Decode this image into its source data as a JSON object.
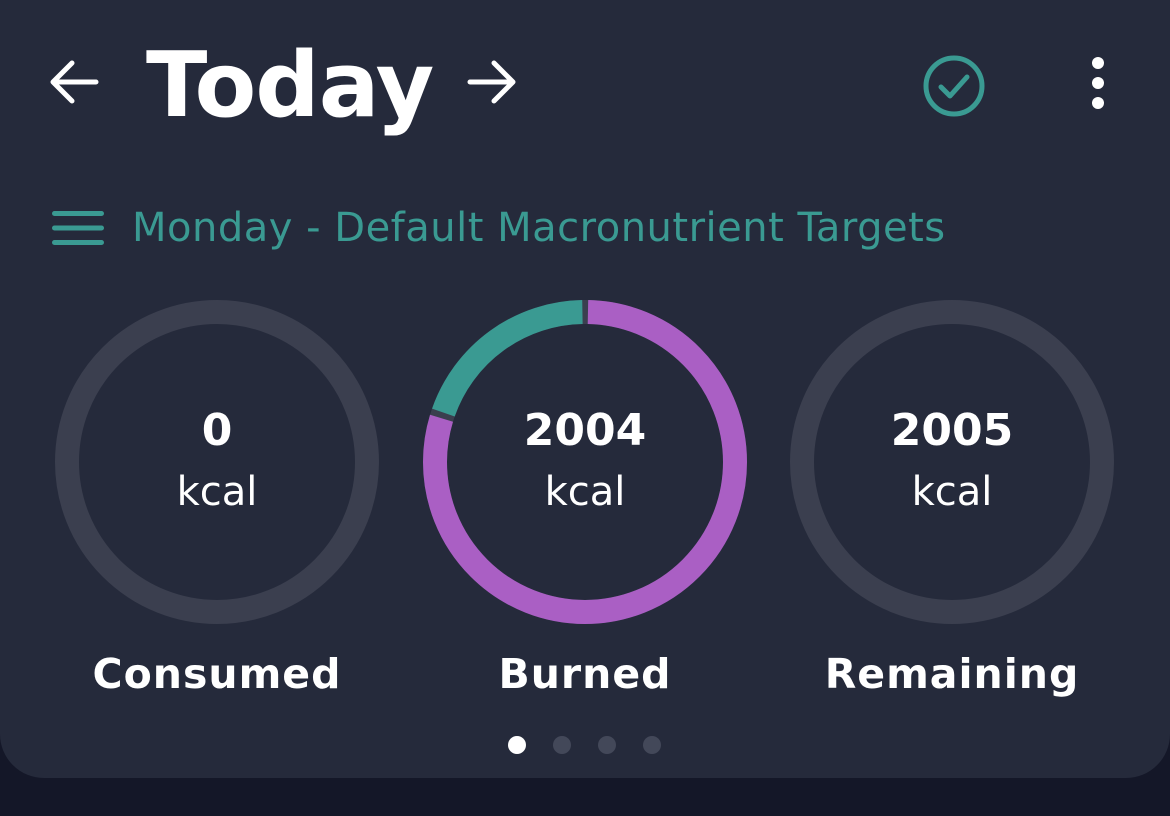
{
  "header": {
    "title": "Today"
  },
  "icons": {
    "back": "arrow-left-icon",
    "forward": "arrow-right-icon",
    "complete": "check-circle-icon",
    "more": "more-vertical-icon",
    "menu": "hamburger-menu-icon"
  },
  "targets": {
    "label": "Monday - Default Macronutrient Targets"
  },
  "colors": {
    "accent": "#3a9a92",
    "burned_arc": "#aa5fc4",
    "track": "#3b3f4f",
    "card": "#252a3b"
  },
  "summary": {
    "consumed": {
      "value": "0",
      "unit": "kcal",
      "label": "Consumed"
    },
    "burned": {
      "value": "2004",
      "unit": "kcal",
      "label": "Burned",
      "teal_fraction": 0.2,
      "purple_fraction": 0.8
    },
    "remaining": {
      "value": "2005",
      "unit": "kcal",
      "label": "Remaining"
    }
  },
  "pager": {
    "pages": 4,
    "active_index": 0
  }
}
